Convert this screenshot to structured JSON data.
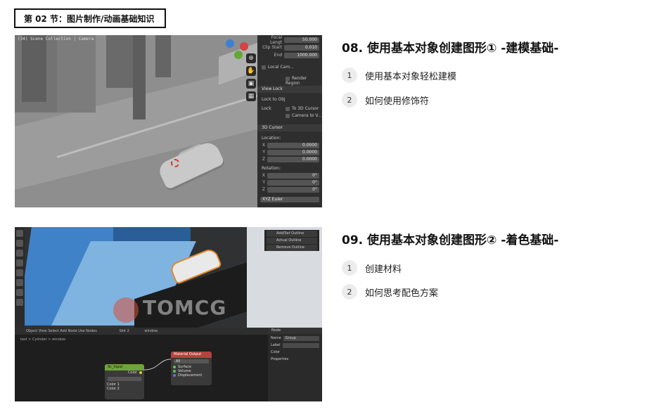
{
  "section_tag": "第 02 节：图片制作/动画基础知识",
  "lessons": [
    {
      "title": "08. 使用基本对象创建图形① -建模基础-",
      "items": [
        {
          "num": "1",
          "text": "使用基本对象轻松建模"
        },
        {
          "num": "2",
          "text": "如何使用修饰符"
        }
      ]
    },
    {
      "title": "09. 使用基本对象创建图形② -着色基础-",
      "items": [
        {
          "num": "1",
          "text": "创建材料"
        },
        {
          "num": "2",
          "text": "如何思考配色方案"
        }
      ]
    }
  ],
  "thumb1": {
    "viewport_label": "(34) Scene Collection | Camera",
    "view_props": [
      {
        "label": "Focal Lengt",
        "value": "50.000"
      },
      {
        "label": "Clip Start",
        "value": "0.010"
      },
      {
        "label": "End",
        "value": "1000.000"
      }
    ],
    "local_camera_label": "Local Cam...",
    "render_region_label": "Render Region",
    "view_lock_header": "View Lock",
    "lock_to_obj_label": "Lock to Obj",
    "lock_label": "Lock",
    "to_3d_cursor_label": "To 3D Cursor",
    "camera_to_view_label": "Camera to V...",
    "cursor_header": "3D Cursor",
    "location_label": "Location:",
    "location": [
      {
        "axis": "X",
        "value": "0.0000"
      },
      {
        "axis": "Y",
        "value": "0.0000"
      },
      {
        "axis": "Z",
        "value": "0.0000"
      }
    ],
    "rotation_label": "Rotation:",
    "rotation": [
      {
        "axis": "X",
        "value": "0°"
      },
      {
        "axis": "Y",
        "value": "0°"
      },
      {
        "axis": "Z",
        "value": "0°"
      }
    ],
    "euler_label": "XYZ Euler"
  },
  "thumb2": {
    "watermark": "TOMCG",
    "outliner_rows": [
      "Add/Set Outline",
      "Actual Outline",
      "Remove Outline"
    ],
    "node_header": "Object  View  Select  Add  Node  Use Nodes",
    "node_slot": "Slot 2",
    "node_material": "window",
    "breadcrumb": "test  >  Cylinder  >  window",
    "nodes": {
      "output_title": "Material Output",
      "output_target": "All",
      "output_sockets": [
        "Surface",
        "Volume",
        "Displacement"
      ],
      "input_title": "Sc_Input",
      "input_socket": "Color",
      "input_rows": [
        "Color 1",
        "Color 2"
      ]
    },
    "props": {
      "node_header": "Node",
      "name_label": "Name",
      "name_value": "Group",
      "label_label": "Label",
      "color_label": "Color",
      "properties_label": "Properties"
    }
  }
}
